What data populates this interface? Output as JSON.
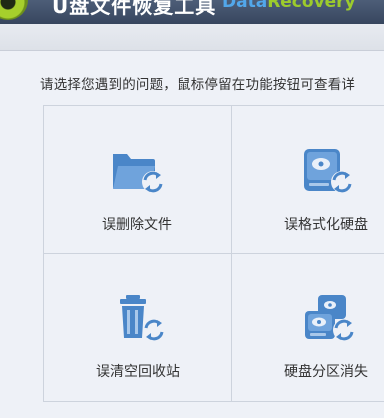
{
  "header": {
    "title": "U盘文件恢复工具",
    "subtitle_part1": "Data",
    "subtitle_part2": "Recovery"
  },
  "instruction": "请选择您遇到的问题，鼠标停留在功能按钮可查看详",
  "options": [
    {
      "label": "误删除文件",
      "icon": "folder-recover-icon"
    },
    {
      "label": "误格式化硬盘",
      "icon": "disk-recover-icon"
    },
    {
      "label": "误清空回收站",
      "icon": "recycle-bin-recover-icon"
    },
    {
      "label": "硬盘分区消失",
      "icon": "partition-recover-icon"
    }
  ],
  "colors": {
    "icon_blue": "#4a86c8",
    "icon_light": "#6fa3dc",
    "header_bg": "#3f4e66",
    "subtitle_blue": "#52a7ea",
    "subtitle_green": "#9ccb2c"
  }
}
